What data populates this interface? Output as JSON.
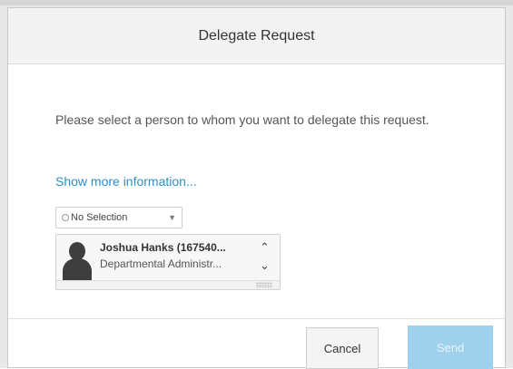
{
  "dialog": {
    "title": "Delegate Request",
    "message": "Please select a person to whom you want to delegate this request.",
    "more_info_link": "Show more information...",
    "selection_dropdown": {
      "selected_value": "No Selection"
    },
    "person": {
      "name": "Joshua Hanks (167540...",
      "role": "Departmental Administr..."
    },
    "buttons": {
      "cancel_label": "Cancel",
      "send_label": "Send"
    }
  },
  "icons": {
    "radio": "radio-icon",
    "caret": "chevron-down-icon",
    "avatar": "avatar-icon",
    "scroll_up": "chevron-up-icon",
    "scroll_down": "chevron-down-icon",
    "resize": "resize-grip-icon"
  },
  "colors": {
    "link": "#2e8fc8",
    "primary_button_disabled": "#9fd0ec",
    "header_background": "#f3f3f3"
  }
}
